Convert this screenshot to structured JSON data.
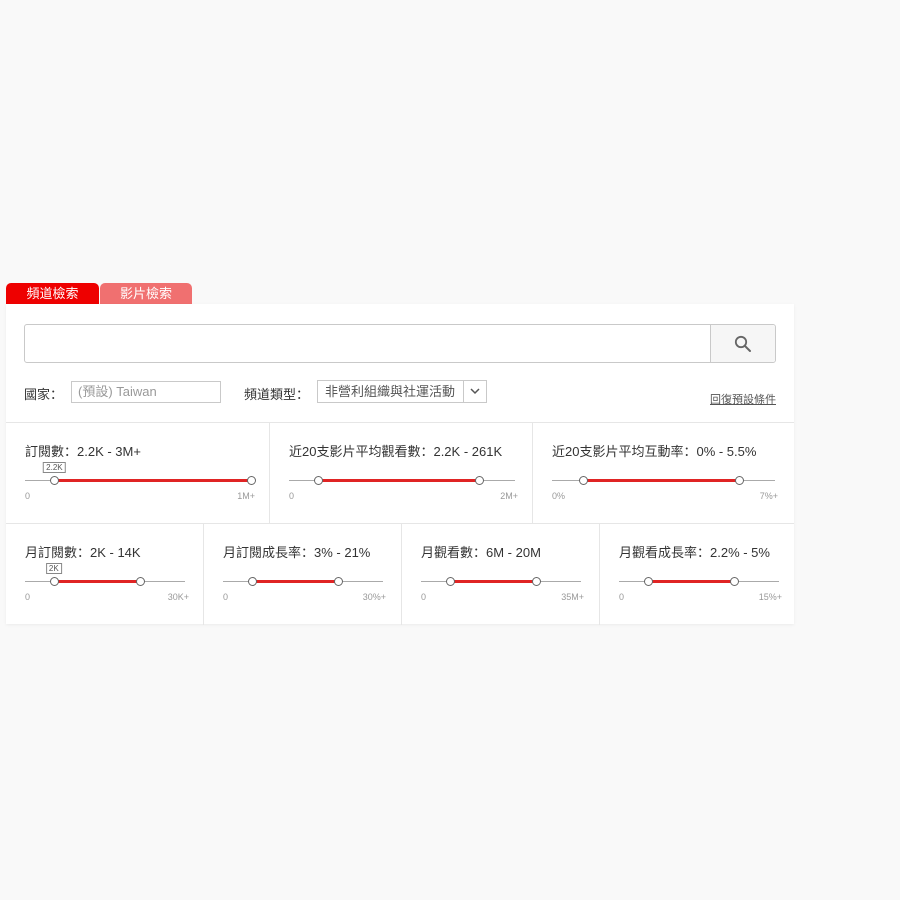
{
  "tabs": {
    "channel": "頻道檢索",
    "video": "影片檢索"
  },
  "search": {
    "value": "",
    "placeholder": ""
  },
  "filters": {
    "country_label": "國家：",
    "country_placeholder": "(預設) Taiwan",
    "type_label": "頻道類型：",
    "type_value": "非營利組織與社運活動",
    "reset": "回復預設條件"
  },
  "metrics": [
    {
      "title": "訂閱數：2.2K - 3M+",
      "min": "0",
      "max": "1M+",
      "low": 0.13,
      "high": 1.0,
      "tip": "2.2K"
    },
    {
      "title": "近20支影片平均觀看數：2.2K - 261K",
      "min": "0",
      "max": "2M+",
      "low": 0.13,
      "high": 0.84
    },
    {
      "title": "近20支影片平均互動率：0% - 5.5%",
      "min": "0%",
      "max": "7%+",
      "low": 0.14,
      "high": 0.84
    },
    {
      "title": "月訂閱數：2K - 14K",
      "min": "0",
      "max": "30K+",
      "low": 0.18,
      "high": 0.72,
      "tip": "2K"
    },
    {
      "title": "月訂閱成長率：3% - 21%",
      "min": "0",
      "max": "30%+",
      "low": 0.18,
      "high": 0.72
    },
    {
      "title": "月觀看數：6M - 20M",
      "min": "0",
      "max": "35M+",
      "low": 0.18,
      "high": 0.72
    },
    {
      "title": "月觀看成長率：2.2% - 5%",
      "min": "0",
      "max": "15%+",
      "low": 0.18,
      "high": 0.72
    }
  ],
  "colors": {
    "accent": "#ee0000",
    "accent_light": "#f07070",
    "fill": "#e02424"
  },
  "icons": {
    "search": "search-icon",
    "dropdown": "chevron-down-icon"
  }
}
